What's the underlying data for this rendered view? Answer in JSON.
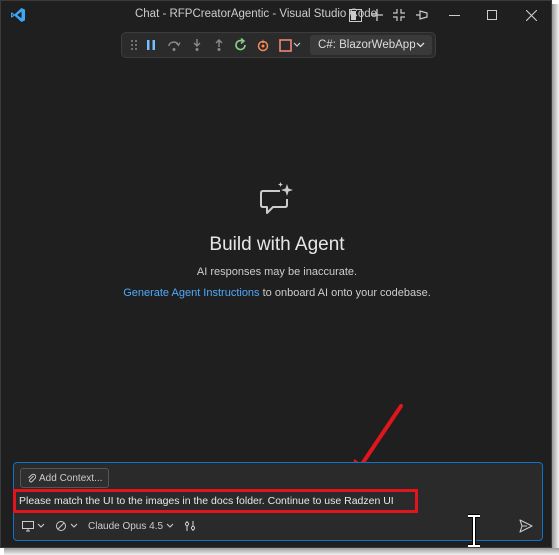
{
  "window": {
    "title": "Chat - RFPCreatorAgentic - Visual Studio Code"
  },
  "titlebar_icons": [
    "layout-panel-icon",
    "plus-icon",
    "collapse-icon",
    "pin-icon",
    "minimize-icon",
    "maximize-icon",
    "close-icon"
  ],
  "debug_toolbar": {
    "buttons": [
      "gripper-icon",
      "pause-icon",
      "step-over-icon",
      "step-into-icon",
      "step-out-icon",
      "restart-icon",
      "hot-reload-icon",
      "stop-icon"
    ],
    "target": "C#: BlazorWebApp"
  },
  "welcome": {
    "title": "Build with Agent",
    "disclaimer": "AI responses may be inaccurate.",
    "link_text": "Generate Agent Instructions",
    "link_suffix": " to onboard AI onto your codebase."
  },
  "chat_input": {
    "add_context_label": "Add Context...",
    "prompt_text": "Please match the UI to the images in the docs folder. Continue to use Radzen UI",
    "model": "Claude Opus 4.5"
  },
  "colors": {
    "background": "#1f1f1f",
    "accent_blue": "#0e72c7",
    "link": "#4daafc",
    "annotation_red": "#e0151d"
  }
}
